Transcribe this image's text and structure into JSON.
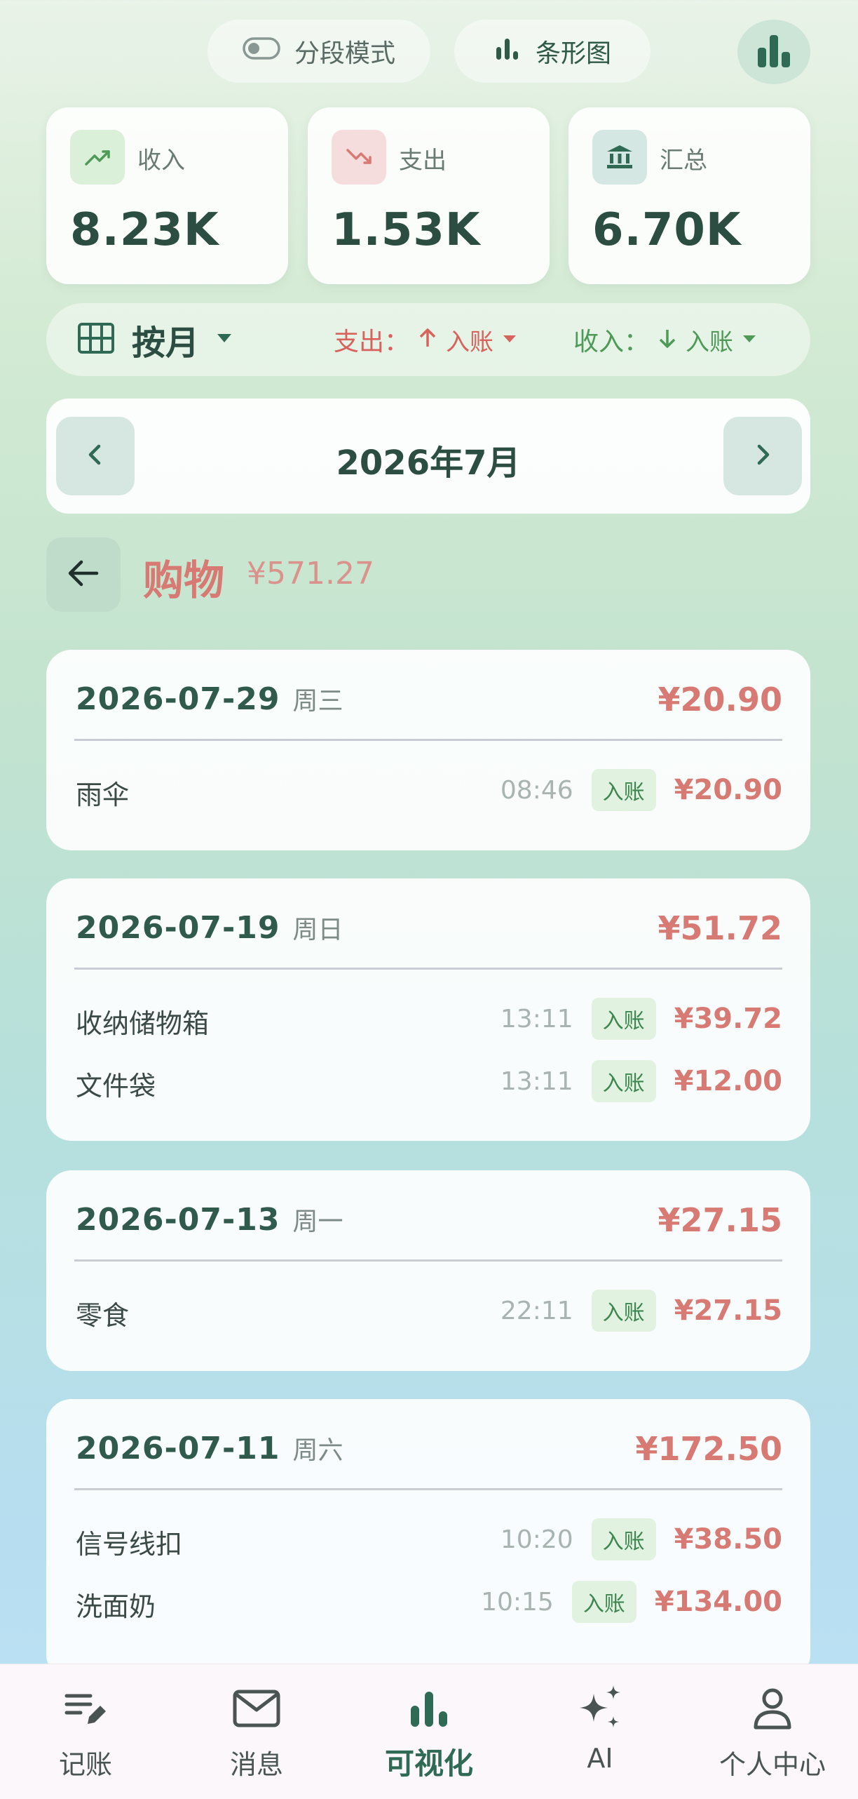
{
  "header": {
    "segment_mode_label": "分段模式",
    "chart_type_label": "条形图"
  },
  "stats": {
    "income": {
      "label": "收入",
      "value": "8.23K"
    },
    "expense": {
      "label": "支出",
      "value": "1.53K"
    },
    "total": {
      "label": "汇总",
      "value": "6.70K"
    }
  },
  "filter": {
    "period_label": "按月",
    "expense_label": "支出：",
    "expense_value": "入账",
    "income_label": "收入：",
    "income_value": "入账"
  },
  "month_nav": {
    "title": "2026年7月"
  },
  "category": {
    "name": "购物",
    "amount": "¥571.27"
  },
  "days": [
    {
      "date": "2026-07-29",
      "weekday": "周三",
      "total": "¥20.90",
      "items": [
        {
          "name": "雨伞",
          "time": "08:46",
          "badge": "入账",
          "amount": "¥20.90"
        }
      ]
    },
    {
      "date": "2026-07-19",
      "weekday": "周日",
      "total": "¥51.72",
      "items": [
        {
          "name": "收纳储物箱",
          "time": "13:11",
          "badge": "入账",
          "amount": "¥39.72"
        },
        {
          "name": "文件袋",
          "time": "13:11",
          "badge": "入账",
          "amount": "¥12.00"
        }
      ]
    },
    {
      "date": "2026-07-13",
      "weekday": "周一",
      "total": "¥27.15",
      "items": [
        {
          "name": "零食",
          "time": "22:11",
          "badge": "入账",
          "amount": "¥27.15"
        }
      ]
    },
    {
      "date": "2026-07-11",
      "weekday": "周六",
      "total": "¥172.50",
      "items": [
        {
          "name": "信号线扣",
          "time": "10:20",
          "badge": "入账",
          "amount": "¥38.50"
        },
        {
          "name": "洗面奶",
          "time": "10:15",
          "badge": "入账",
          "amount": "¥134.00"
        }
      ]
    }
  ],
  "bottom_nav": {
    "items": [
      {
        "label": "记账",
        "icon": "edit-note-icon"
      },
      {
        "label": "消息",
        "icon": "mail-icon"
      },
      {
        "label": "可视化",
        "icon": "bar-chart-icon"
      },
      {
        "label": "AI",
        "icon": "sparkle-icon"
      },
      {
        "label": "个人中心",
        "icon": "person-icon"
      }
    ],
    "active_index": 2
  },
  "colors": {
    "accent": "#2f6a55",
    "expense": "#d77a74",
    "income": "#4f9a58",
    "badge_bg": "#e1f2e0"
  }
}
